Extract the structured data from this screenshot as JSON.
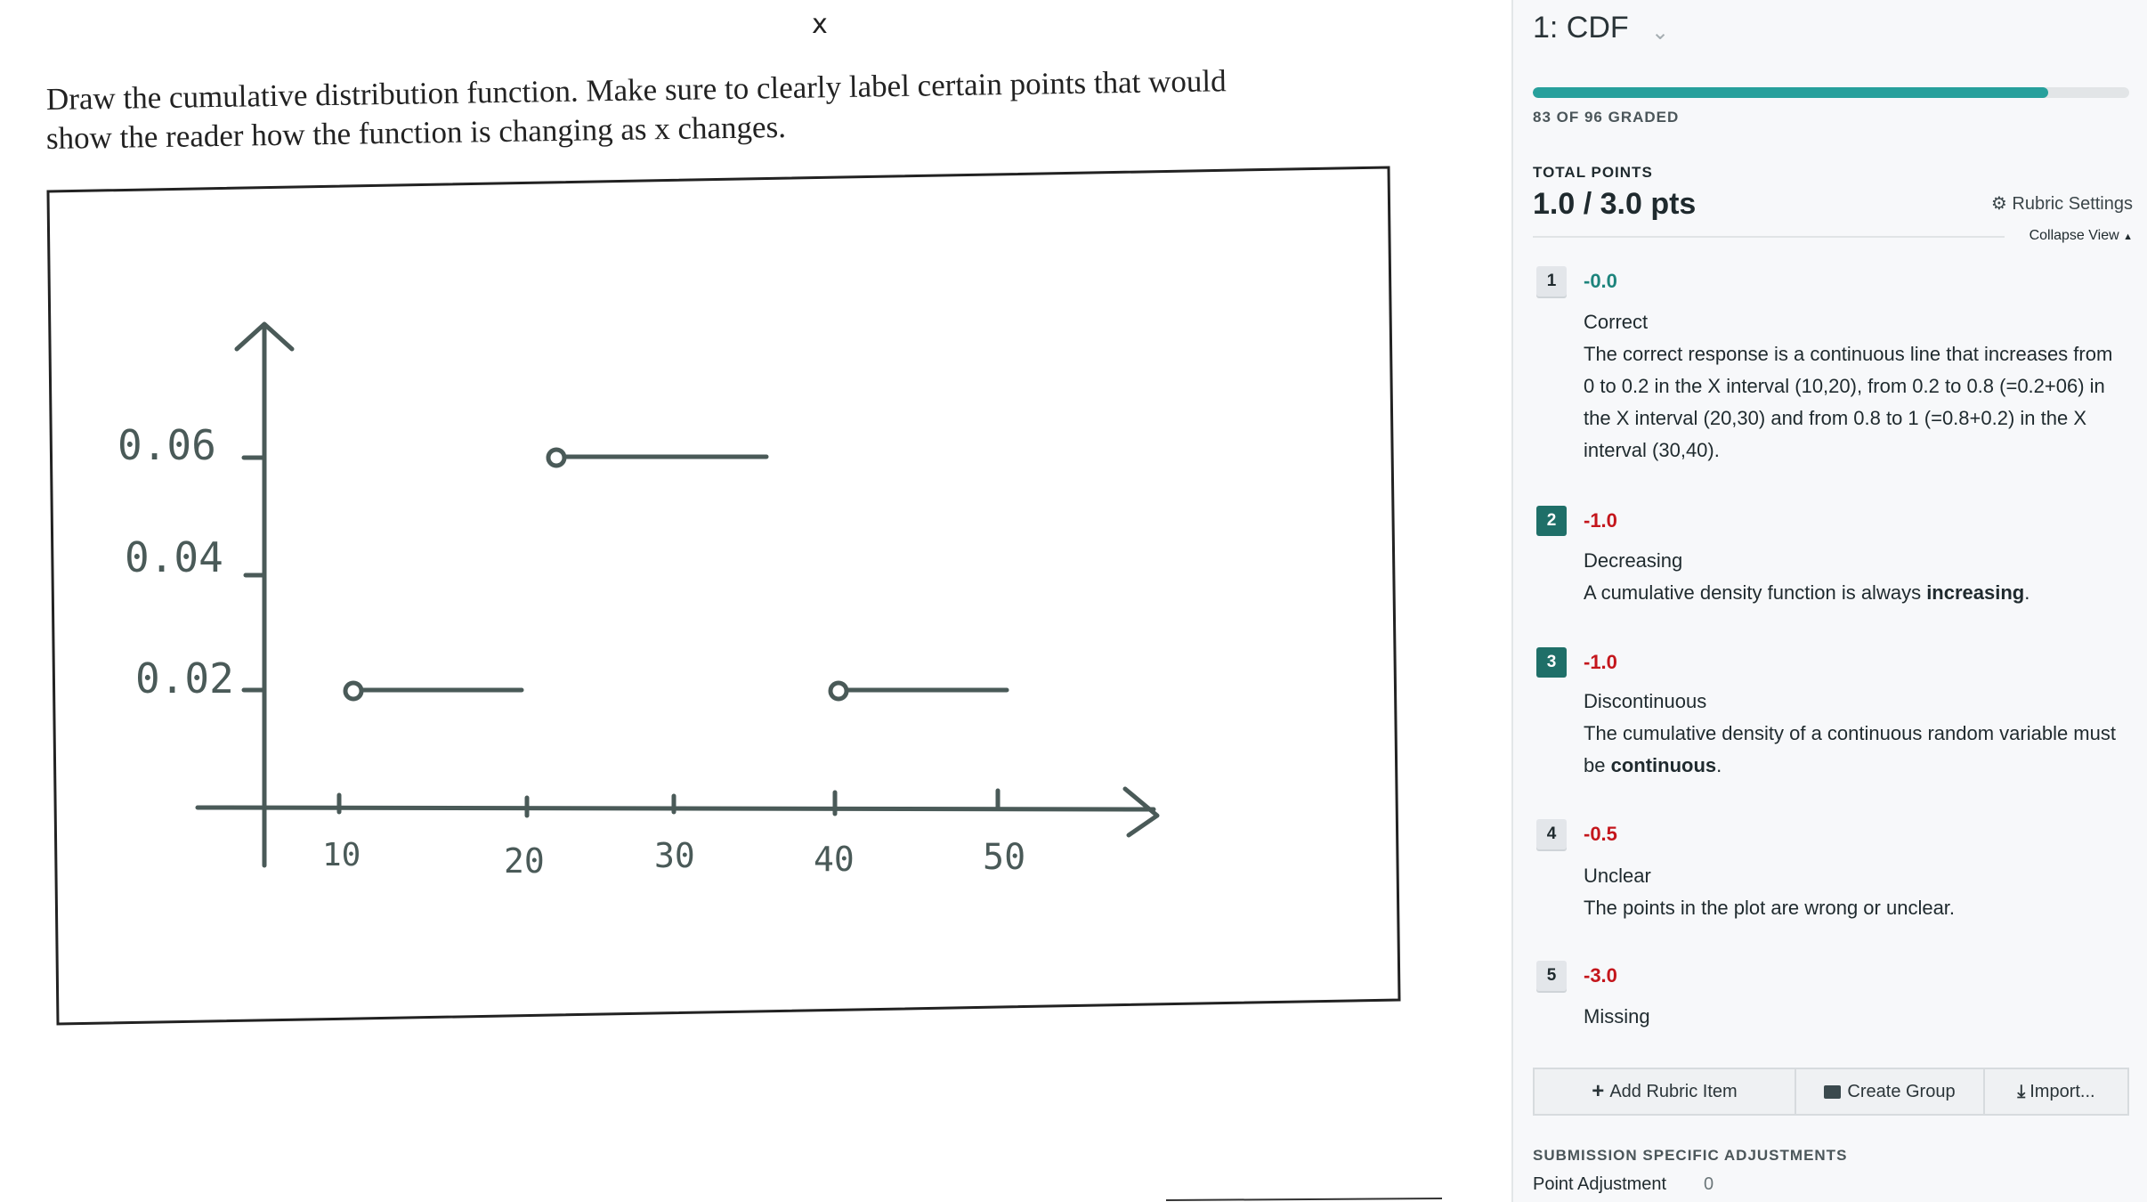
{
  "submission": {
    "variable_label": "x",
    "question_lines": [
      "Draw the cumulative distribution function.  Make sure to clearly label certain points that would",
      "show the reader how the function is changing as x changes."
    ],
    "sketch": {
      "y_labels": [
        "0.06",
        "0.04",
        "0.02"
      ],
      "x_labels": [
        "10",
        "20",
        "30",
        "40",
        "50"
      ]
    }
  },
  "panel": {
    "question_title": "1: CDF",
    "progress": {
      "graded": 83,
      "total": 96,
      "label": "83 OF 96 GRADED",
      "color": "#27a09c"
    },
    "total_points_label": "TOTAL POINTS",
    "total_points_value": "1.0 / 3.0 pts",
    "rubric_settings_label": "Rubric Settings",
    "collapse_view_label": "Collapse View",
    "rubric_items": [
      {
        "number": "1",
        "score": "-0.0",
        "title": "Correct",
        "selected": false,
        "description": "The correct response is a continuous line that increases from 0 to 0.2 in the X interval (10,20), from 0.2 to 0.8 (=0.2+06) in the X interval (20,30) and from 0.8 to 1 (=0.8+0.2) in the X interval (30,40)."
      },
      {
        "number": "2",
        "score": "-1.0",
        "title": "Decreasing",
        "selected": true,
        "description_pre": "A cumulative density function is always ",
        "description_bold": "increasing",
        "description_post": "."
      },
      {
        "number": "3",
        "score": "-1.0",
        "title": "Discontinuous",
        "selected": true,
        "description_pre": "The cumulative density of a continuous random variable must  be ",
        "description_bold": "continuous",
        "description_post": "."
      },
      {
        "number": "4",
        "score": "-0.5",
        "title": "Unclear",
        "selected": false,
        "description": "The points in the plot are wrong or unclear."
      },
      {
        "number": "5",
        "score": "-3.0",
        "title": "Missing",
        "selected": false
      }
    ],
    "buttons": {
      "add": "Add Rubric Item",
      "group": "Create Group",
      "import": "Import..."
    },
    "adjustments_label": "SUBMISSION SPECIFIC ADJUSTMENTS",
    "point_adjustment_label": "Point Adjustment",
    "point_adjustment_value": "0"
  }
}
